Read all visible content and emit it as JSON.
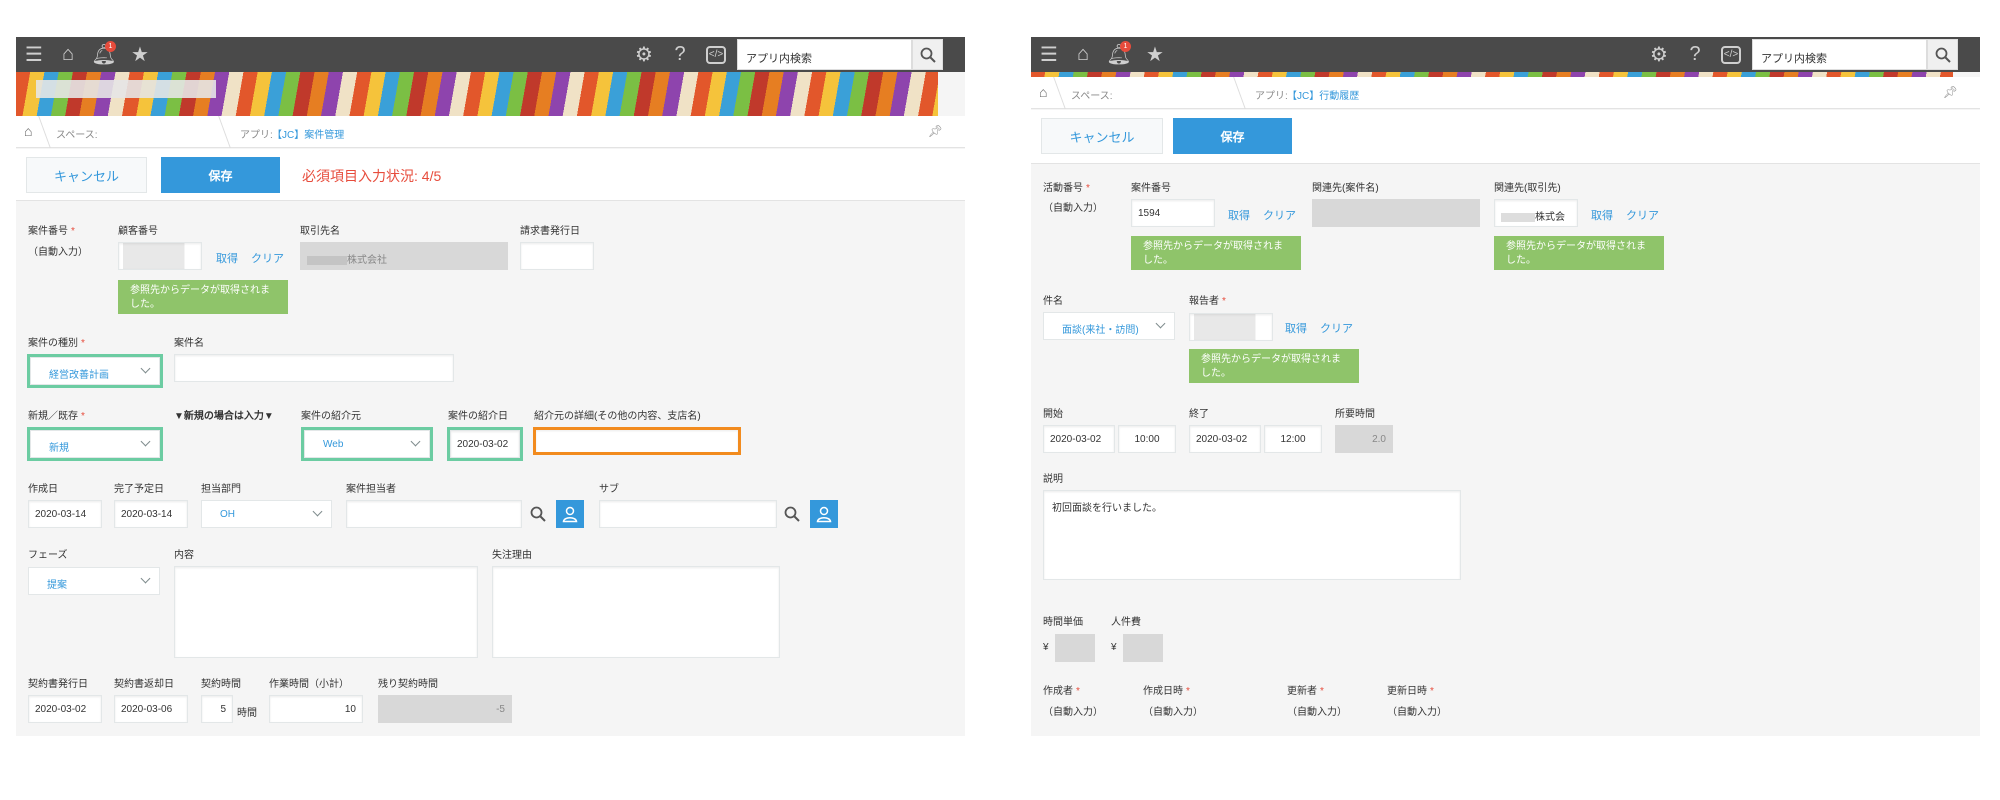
{
  "common": {
    "search_placeholder": "アプリ内検索",
    "notification_count": "1",
    "cancel_label": "キャンセル",
    "save_label": "保存",
    "lookup_get": "取得",
    "lookup_clear": "クリア",
    "lookup_message": "参照先からデータが取得されました。",
    "auto_input": "（自動入力）",
    "space_label": "スペース:",
    "app_label": "アプリ:"
  },
  "left": {
    "breadcrumb_app": "【JC】案件管理",
    "required_status": "必須項目入力状況: 4/5",
    "fields": {
      "case_no_label": "案件番号",
      "customer_no_label": "顧客番号",
      "client_name_label": "取引先名",
      "client_name_value": "株式会社",
      "invoice_date_label": "請求書発行日",
      "case_type_label": "案件の種別",
      "case_type_value": "経営改善計画",
      "case_name_label": "案件名",
      "new_existing_label": "新規／既存",
      "new_existing_value": "新規",
      "new_note": "▼新規の場合は入力▼",
      "referrer_label": "案件の紹介元",
      "referrer_value": "Web",
      "referral_date_label": "案件の紹介日",
      "referral_date_value": "2020-03-02",
      "referral_detail_label": "紹介元の詳細(その他の内容、支店名)",
      "created_date_label": "作成日",
      "created_date_value": "2020-03-14",
      "due_date_label": "完了予定日",
      "due_date_value": "2020-03-14",
      "dept_label": "担当部門",
      "dept_value": "OH",
      "owner_label": "案件担当者",
      "sub_label": "サブ",
      "phase_label": "フェーズ",
      "phase_value": "提案",
      "content_label": "内容",
      "lost_reason_label": "失注理由",
      "contract_issue_label": "契約書発行日",
      "contract_issue_value": "2020-03-02",
      "contract_return_label": "契約書返却日",
      "contract_return_value": "2020-03-06",
      "contract_hours_label": "契約時間",
      "contract_hours_value": "5",
      "hours_unit": "時間",
      "work_hours_label": "作業時間（小計）",
      "work_hours_value": "10",
      "remaining_label": "残り契約時間",
      "remaining_value": "-5"
    }
  },
  "right": {
    "breadcrumb_app": "【JC】行動履歴",
    "fields": {
      "activity_no_label": "活動番号",
      "case_no_label": "案件番号",
      "case_no_value": "1594",
      "related_case_label": "関連先(案件名)",
      "related_client_label": "関連先(取引先)",
      "related_client_value": "株式会",
      "subject_label": "件名",
      "subject_value": "面談(来社・訪問)",
      "reporter_label": "報告者",
      "start_label": "開始",
      "start_date": "2020-03-02",
      "start_time": "10:00",
      "end_label": "終了",
      "end_date": "2020-03-02",
      "end_time": "12:00",
      "duration_label": "所要時間",
      "duration_value": "2.0",
      "description_label": "説明",
      "description_value": "初回面談を行いました。",
      "hourly_rate_label": "時間単価",
      "labor_cost_label": "人件費",
      "currency": "¥",
      "creator_label": "作成者",
      "created_at_label": "作成日時",
      "updater_label": "更新者",
      "updated_at_label": "更新日時"
    }
  },
  "colors": {
    "accent": "#3498db",
    "highlight_green": "#6ccca2",
    "highlight_orange": "#f28b1e",
    "lookup_green": "#8fc46a",
    "required_red": "#e74c3c",
    "topbar": "#4a4a4a"
  },
  "icons": [
    "menu-icon",
    "home-icon",
    "bell-icon",
    "star-icon",
    "gear-icon",
    "help-icon",
    "code-icon",
    "search-icon",
    "pin-icon",
    "user-icon",
    "chevron-down-icon"
  ]
}
